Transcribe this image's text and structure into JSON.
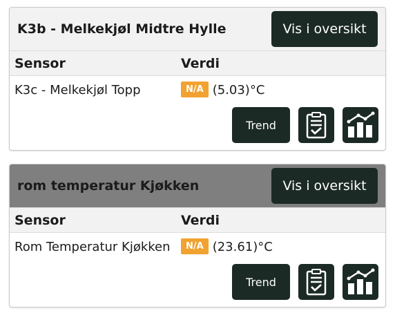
{
  "cards": [
    {
      "title": "K3b - Melkekjøl Midtre Hylle",
      "overview_label": "Vis i oversikt",
      "header_sensor": "Sensor",
      "header_value": "Verdi",
      "sensor_name": "K3c - Melkekjøl Topp",
      "status_badge": "N/A",
      "reading": "(5.03)°C",
      "trend_label": "Trend",
      "report_icon": "clipboard-check-icon",
      "chart_icon": "bar-chart-trend-icon"
    },
    {
      "title": "rom temperatur Kjøkken",
      "overview_label": "Vis i oversikt",
      "header_sensor": "Sensor",
      "header_value": "Verdi",
      "sensor_name": "Rom Temperatur Kjøkken",
      "status_badge": "N/A",
      "reading": "(23.61)°C",
      "trend_label": "Trend",
      "report_icon": "clipboard-check-icon",
      "chart_icon": "bar-chart-trend-icon"
    }
  ],
  "colors": {
    "dark_button": "#1c2a25",
    "badge": "#f2a230",
    "header_light": "#f2f2f2",
    "header_gray": "#7f7f7f"
  }
}
